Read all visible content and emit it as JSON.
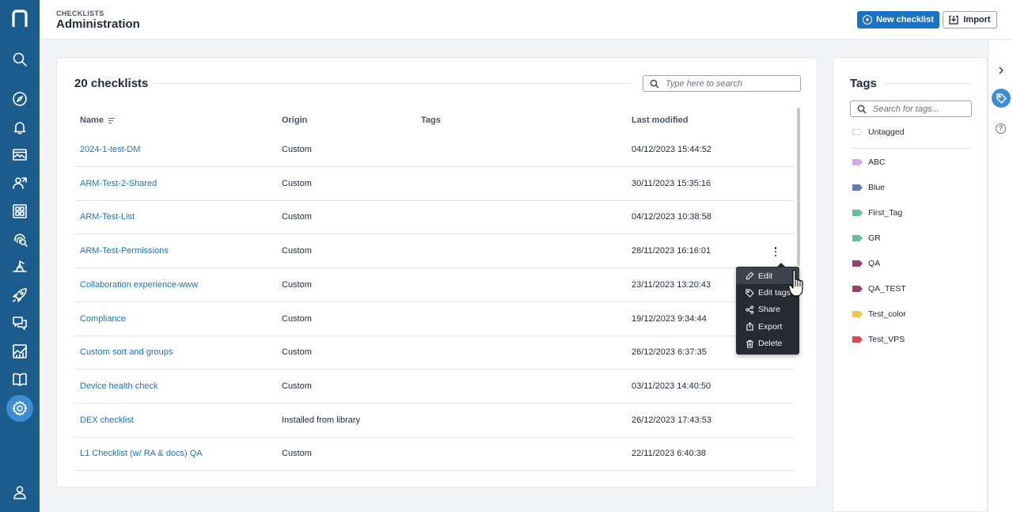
{
  "header": {
    "breadcrumb": "CHECKLISTS",
    "title": "Administration",
    "new_checklist_label": "New checklist",
    "import_label": "Import"
  },
  "nav": {
    "items": [
      "search-icon",
      "compass-icon",
      "bell-icon",
      "monitor-icon",
      "users-icon",
      "apps-icon",
      "fingerprint-icon",
      "workflow-icon",
      "rocket-icon",
      "chat-icon",
      "chart-icon",
      "book-icon",
      "gear-icon",
      "user-icon"
    ],
    "active": "gear-icon",
    "colors": {
      "background": "#1b5c8c",
      "active": "#3b8ed4"
    }
  },
  "main": {
    "count_label": "20 checklists",
    "search_placeholder": "Type here to search",
    "columns": {
      "name": "Name",
      "origin": "Origin",
      "tags": "Tags",
      "modified": "Last modified"
    },
    "rows": [
      {
        "name": "2024-1-test-DM",
        "origin": "Custom",
        "modified": "04/12/2023 15:44:52"
      },
      {
        "name": "ARM-Test-2-Shared",
        "origin": "Custom",
        "modified": "30/11/2023 15:35:16"
      },
      {
        "name": "ARM-Test-List",
        "origin": "Custom",
        "modified": "04/12/2023 10:38:58"
      },
      {
        "name": "ARM-Test-Permissions",
        "origin": "Custom",
        "modified": "28/11/2023 16:16:01"
      },
      {
        "name": "Collaboration experience-www",
        "origin": "Custom",
        "modified": "23/11/2023 13:20:43"
      },
      {
        "name": "Compliance",
        "origin": "Custom",
        "modified": "19/12/2023 9:34:44"
      },
      {
        "name": "Custom sort and groups",
        "origin": "Custom",
        "modified": "26/12/2023 6:37:35"
      },
      {
        "name": "Device health check",
        "origin": "Custom",
        "modified": "03/11/2023 14:40:50"
      },
      {
        "name": "DEX checklist",
        "origin": "Installed from library",
        "modified": "26/12/2023 17:43:53"
      },
      {
        "name": "L1 Checklist (w/ RA & docs) QA",
        "origin": "Custom",
        "modified": "22/11/2023 6:40:38"
      }
    ]
  },
  "context_menu": {
    "items": [
      {
        "label": "Edit",
        "icon": "pencil-icon"
      },
      {
        "label": "Edit tags",
        "icon": "tag-icon"
      },
      {
        "label": "Share",
        "icon": "share-icon"
      },
      {
        "label": "Export",
        "icon": "export-icon"
      },
      {
        "label": "Delete",
        "icon": "trash-icon"
      }
    ]
  },
  "tags_panel": {
    "title": "Tags",
    "search_placeholder": "Search for tags...",
    "untagged_label": "Untagged",
    "tags": [
      {
        "label": "ABC",
        "color": "#d4a5f0"
      },
      {
        "label": "Blue",
        "color": "#5b7fb5"
      },
      {
        "label": "First_Tag",
        "color": "#5fc48f"
      },
      {
        "label": "GR",
        "color": "#5fc48f"
      },
      {
        "label": "QA",
        "color": "#9c3f6e"
      },
      {
        "label": "QA_TEST",
        "color": "#9c3f6e"
      },
      {
        "label": "Test_color",
        "color": "#f5c445"
      },
      {
        "label": "Test_VPS",
        "color": "#e0474c"
      }
    ]
  },
  "accent": "#1a73c2"
}
